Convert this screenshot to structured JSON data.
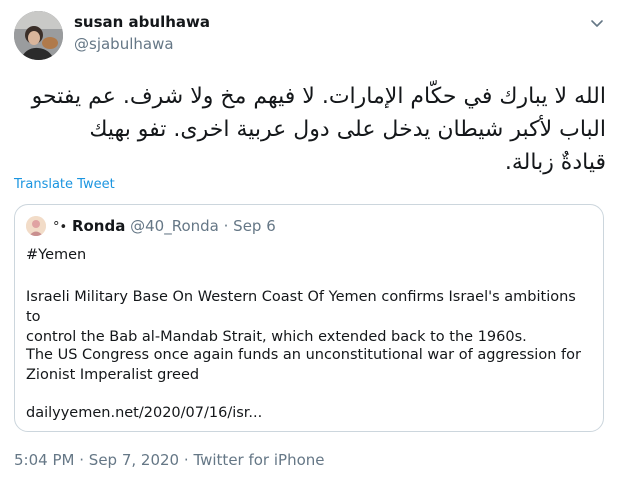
{
  "author": {
    "name": "susan abulhawa",
    "handle": "@sjabulhawa"
  },
  "tweet": {
    "text_lines": [
      "الله لا يبارك في حكّام الإمارات. لا فيهم مخ ولا شرف. عم يفتحو",
      "الباب لأكبر شيطان يدخل على دول عربية اخرى. تفو بهيك",
      "قيادةٌ زبالة."
    ],
    "translate_label": "Translate Tweet"
  },
  "quoted": {
    "emoji": "°•",
    "name": "Ronda",
    "meta": "@40_Ronda · Sep 6",
    "hashtag": "#Yemen",
    "paragraph1_lines": [
      "Israeli Military Base On Western Coast Of Yemen confirms Israel's ambitions to",
      "control the Bab al-Mandab Strait, which extended back to the 1960s."
    ],
    "paragraph2_lines": [
      "The US Congress once again funds an unconstitutional war of aggression for",
      "Zionist Imperalist greed"
    ],
    "link": "dailyyemen.net/2020/07/16/isr..."
  },
  "footer": {
    "time": "5:04 PM",
    "date": "Sep 7, 2020",
    "source": "Twitter for iPhone",
    "sep": "·"
  },
  "colors": {
    "link": "#1b95e0",
    "secondary": "#657786",
    "border": "#ccd6dd"
  },
  "icons": {
    "caret": "chevron-down-icon",
    "avatar": "profile-photo",
    "quoted_avatar": "profile-photo"
  }
}
